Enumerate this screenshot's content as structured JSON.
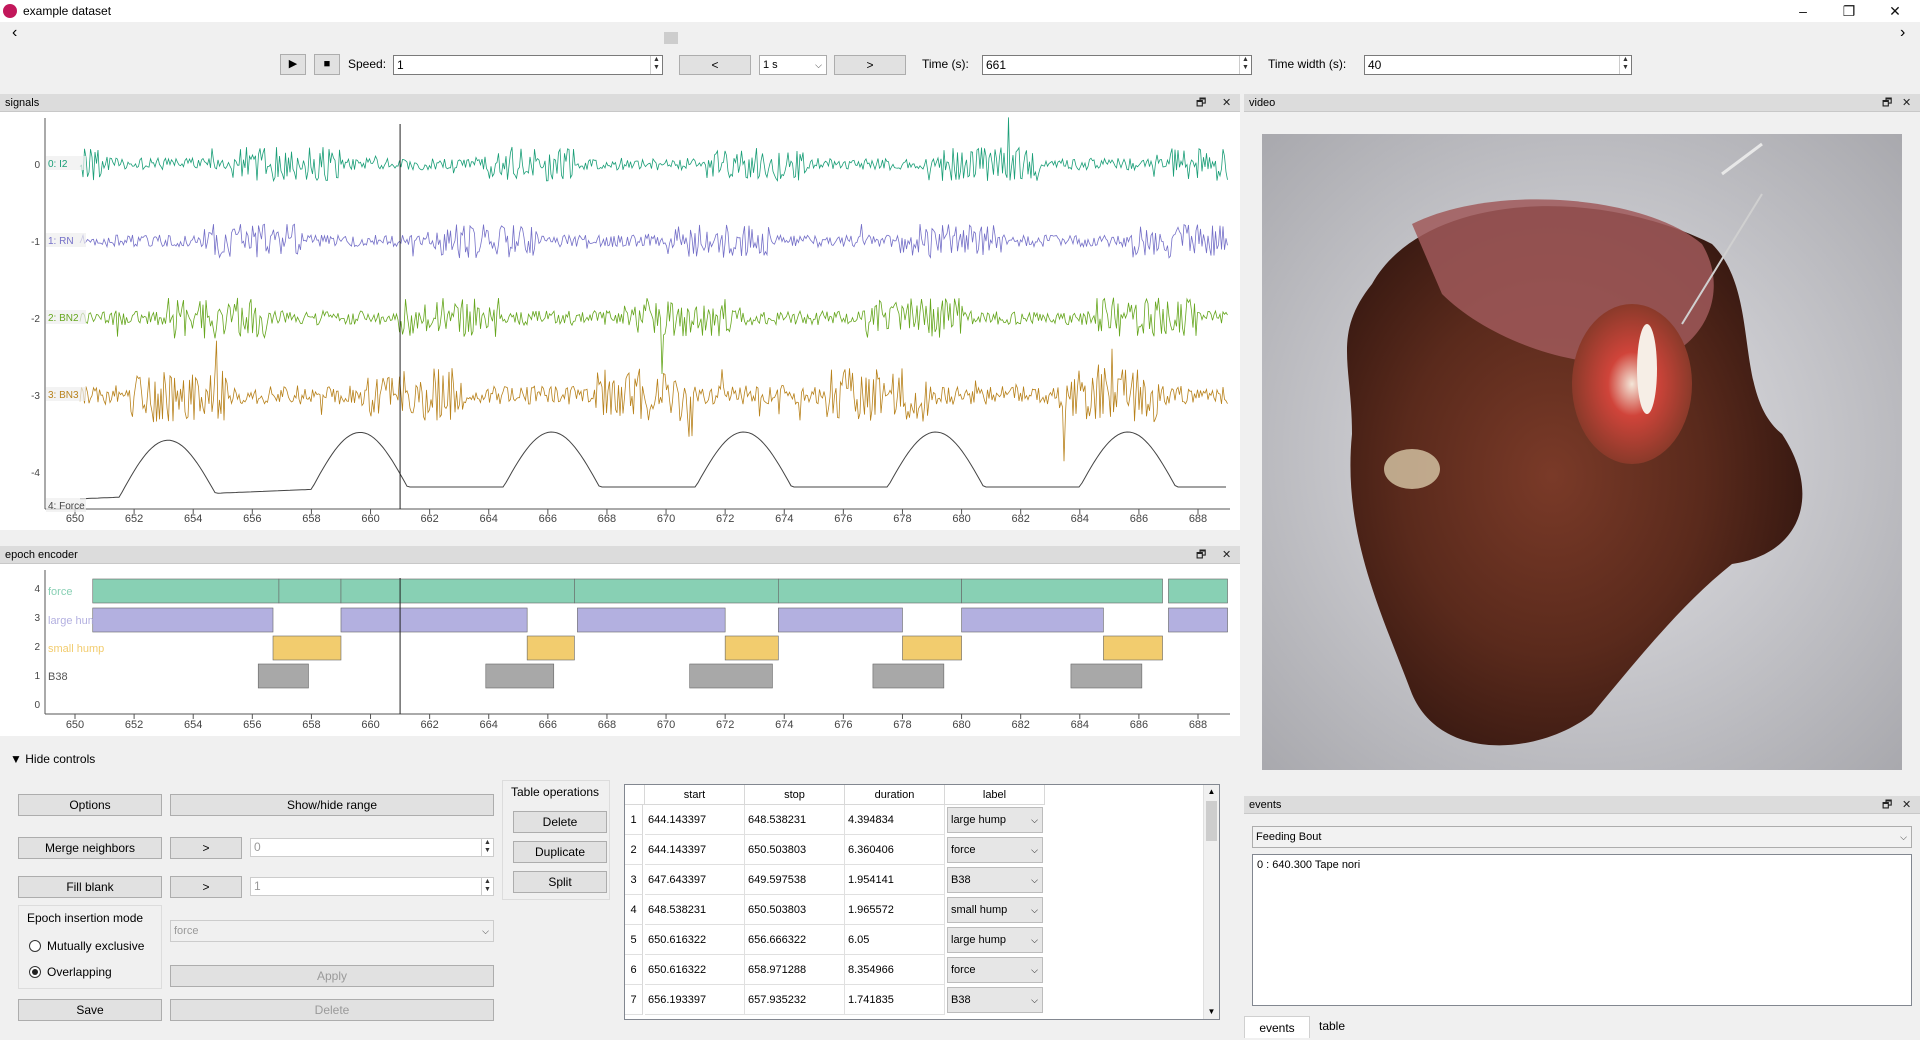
{
  "window": {
    "title": "example dataset",
    "minimize": "–",
    "maximize": "❐",
    "close": "✕"
  },
  "nav": {
    "left": "‹",
    "right": "›"
  },
  "toolbar": {
    "play": "▶",
    "stop": "■",
    "speed_label": "Speed:",
    "speed_value": "1",
    "prev": "<",
    "step_value": "1 s",
    "next": ">",
    "time_label": "Time (s):",
    "time_value": "661",
    "width_label": "Time width (s):",
    "width_value": "40"
  },
  "signals": {
    "title": "signals",
    "float_icon": "🗗",
    "close_icon": "✕",
    "y_ticks": [
      "0",
      "-1",
      "-2",
      "-3",
      "-4"
    ],
    "channels": [
      "0: I2",
      "1: RN",
      "2: BN2",
      "3: BN3",
      "4: Force"
    ],
    "colors": [
      "#1a9e77",
      "#7570c8",
      "#66a61e",
      "#b8821c",
      "#444444"
    ],
    "x_ticks": [
      "650",
      "652",
      "654",
      "656",
      "658",
      "660",
      "662",
      "664",
      "666",
      "668",
      "670",
      "672",
      "674",
      "676",
      "678",
      "680",
      "682",
      "684",
      "686",
      "688"
    ],
    "cursor_time": 661
  },
  "video": {
    "title": "video",
    "float_icon": "🗗",
    "close_icon": "✕"
  },
  "epoch_encoder": {
    "title": "epoch encoder",
    "float_icon": "🗗",
    "close_icon": "✕",
    "y_ticks": [
      "4",
      "3",
      "2",
      "1",
      "0"
    ],
    "labels": [
      "force",
      "large hump",
      "small hump",
      "B38"
    ],
    "colors": {
      "force": "#88d0b4",
      "large_hump": "#b3b0e0",
      "small_hump": "#f2cc6e",
      "B38": "#a8a8a8"
    },
    "x_ticks": [
      "650",
      "652",
      "654",
      "656",
      "658",
      "660",
      "662",
      "664",
      "666",
      "668",
      "670",
      "672",
      "674",
      "676",
      "678",
      "680",
      "682",
      "684",
      "686",
      "688"
    ],
    "epochs": [
      {
        "label": "force",
        "start": 650.6,
        "stop": 656.9
      },
      {
        "label": "force",
        "start": 656.9,
        "stop": 659.0
      },
      {
        "label": "force",
        "start": 659.0,
        "stop": 666.9
      },
      {
        "label": "force",
        "start": 666.9,
        "stop": 673.8
      },
      {
        "label": "force",
        "start": 673.8,
        "stop": 680.0
      },
      {
        "label": "force",
        "start": 680.0,
        "stop": 686.8
      },
      {
        "label": "force",
        "start": 687.0,
        "stop": 689.0
      },
      {
        "label": "large hump",
        "start": 650.6,
        "stop": 656.7
      },
      {
        "label": "large hump",
        "start": 659.0,
        "stop": 665.3
      },
      {
        "label": "large hump",
        "start": 667.0,
        "stop": 672.0
      },
      {
        "label": "large hump",
        "start": 673.8,
        "stop": 678.0
      },
      {
        "label": "large hump",
        "start": 680.0,
        "stop": 684.8
      },
      {
        "label": "large hump",
        "start": 687.0,
        "stop": 689.0
      },
      {
        "label": "small hump",
        "start": 656.7,
        "stop": 659.0
      },
      {
        "label": "small hump",
        "start": 665.3,
        "stop": 666.9
      },
      {
        "label": "small hump",
        "start": 672.0,
        "stop": 673.8
      },
      {
        "label": "small hump",
        "start": 678.0,
        "stop": 680.0
      },
      {
        "label": "small hump",
        "start": 684.8,
        "stop": 686.8
      },
      {
        "label": "B38",
        "start": 656.2,
        "stop": 657.9
      },
      {
        "label": "B38",
        "start": 663.9,
        "stop": 666.2
      },
      {
        "label": "B38",
        "start": 670.8,
        "stop": 673.6
      },
      {
        "label": "B38",
        "start": 677.0,
        "stop": 679.4
      },
      {
        "label": "B38",
        "start": 683.7,
        "stop": 686.1
      }
    ]
  },
  "controls": {
    "hide_controls": "Hide controls",
    "options": "Options",
    "show_hide_range": "Show/hide range",
    "merge_neighbors": "Merge neighbors",
    "merge_arrow": ">",
    "merge_value": "0",
    "fill_blank": "Fill blank",
    "fill_arrow": ">",
    "fill_value": "1",
    "insertion_mode": "Epoch insertion mode",
    "mutually_exclusive": "Mutually exclusive",
    "overlapping": "Overlapping",
    "label_select": "force",
    "apply": "Apply",
    "save": "Save",
    "delete_bottom": "Delete",
    "table_operations": "Table operations",
    "delete": "Delete",
    "duplicate": "Duplicate",
    "split": "Split"
  },
  "epoch_table": {
    "headers": [
      "start",
      "stop",
      "duration",
      "label"
    ],
    "rows": [
      {
        "n": "1",
        "start": "644.143397",
        "stop": "648.538231",
        "duration": "4.394834",
        "label": "large hump"
      },
      {
        "n": "2",
        "start": "644.143397",
        "stop": "650.503803",
        "duration": "6.360406",
        "label": "force"
      },
      {
        "n": "3",
        "start": "647.643397",
        "stop": "649.597538",
        "duration": "1.954141",
        "label": "B38"
      },
      {
        "n": "4",
        "start": "648.538231",
        "stop": "650.503803",
        "duration": "1.965572",
        "label": "small hump"
      },
      {
        "n": "5",
        "start": "650.616322",
        "stop": "656.666322",
        "duration": "6.05",
        "label": "large hump"
      },
      {
        "n": "6",
        "start": "650.616322",
        "stop": "658.971288",
        "duration": "8.354966",
        "label": "force"
      },
      {
        "n": "7",
        "start": "656.193397",
        "stop": "657.935232",
        "duration": "1.741835",
        "label": "B38"
      }
    ]
  },
  "events": {
    "title": "events",
    "float_icon": "🗗",
    "close_icon": "✕",
    "selected": "Feeding Bout",
    "items": [
      "0 : 640.300 Tape nori"
    ],
    "tab_events": "events",
    "tab_table": "table"
  }
}
